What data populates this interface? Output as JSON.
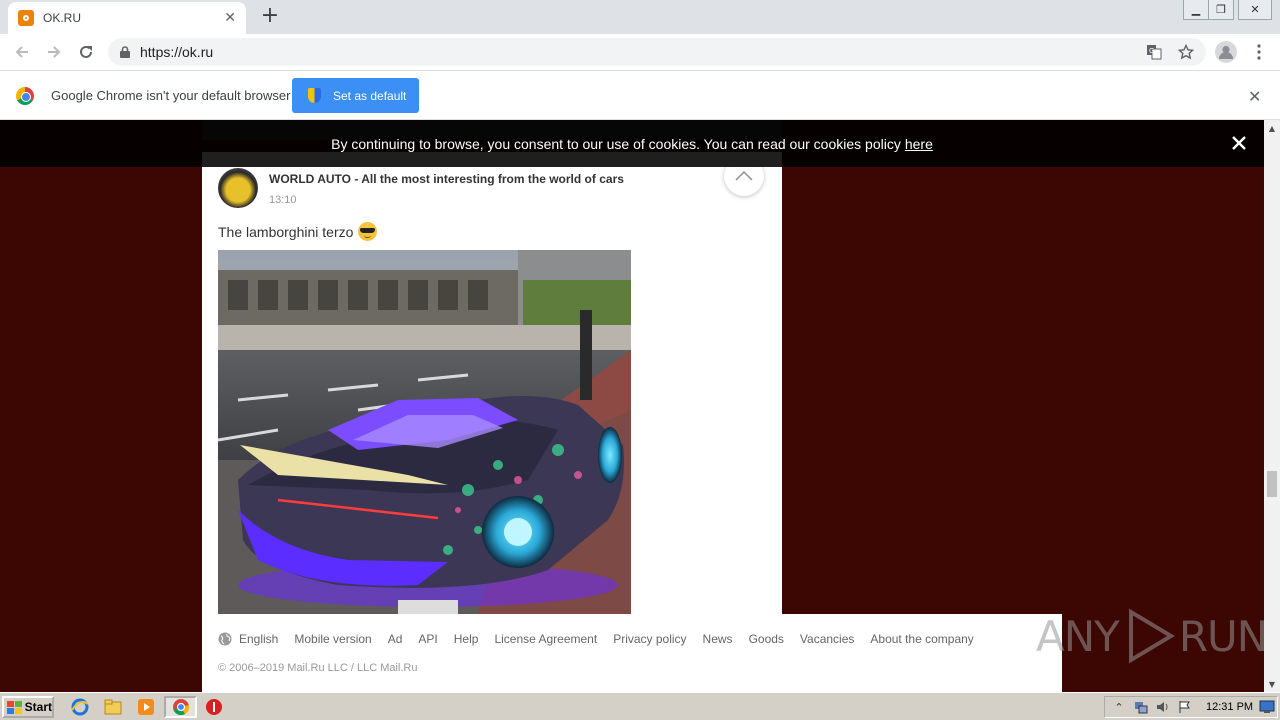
{
  "browser": {
    "tab_title": "OK.RU",
    "url": "https://ok.ru",
    "infobar_message": "Google Chrome isn't your default browser",
    "infobar_button": "Set as default"
  },
  "cookie_banner": {
    "text": "By continuing to browse, you consent to our use of cookies. You can read our cookies policy",
    "link": "here"
  },
  "post": {
    "author": "WORLD AUTO - All the most interesting from the world of cars",
    "time": "13:10",
    "text": "The lamborghini terzo",
    "emoji": "sunglasses-emoji"
  },
  "footer": {
    "links": [
      "English",
      "Mobile version",
      "Ad",
      "API",
      "Help",
      "License Agreement",
      "Privacy policy",
      "News",
      "Goods",
      "Vacancies",
      "About the company"
    ],
    "copyright": "© 2006–2019 Mail.Ru LLC / LLC Mail.Ru"
  },
  "watermark": {
    "left": "ANY",
    "right": "RUN"
  },
  "taskbar": {
    "start_label": "Start",
    "clock": "12:31 PM"
  },
  "colors": {
    "page_background": "#3c0602",
    "accent_button": "#3c8ff4",
    "ok_orange": "#ee8208"
  }
}
